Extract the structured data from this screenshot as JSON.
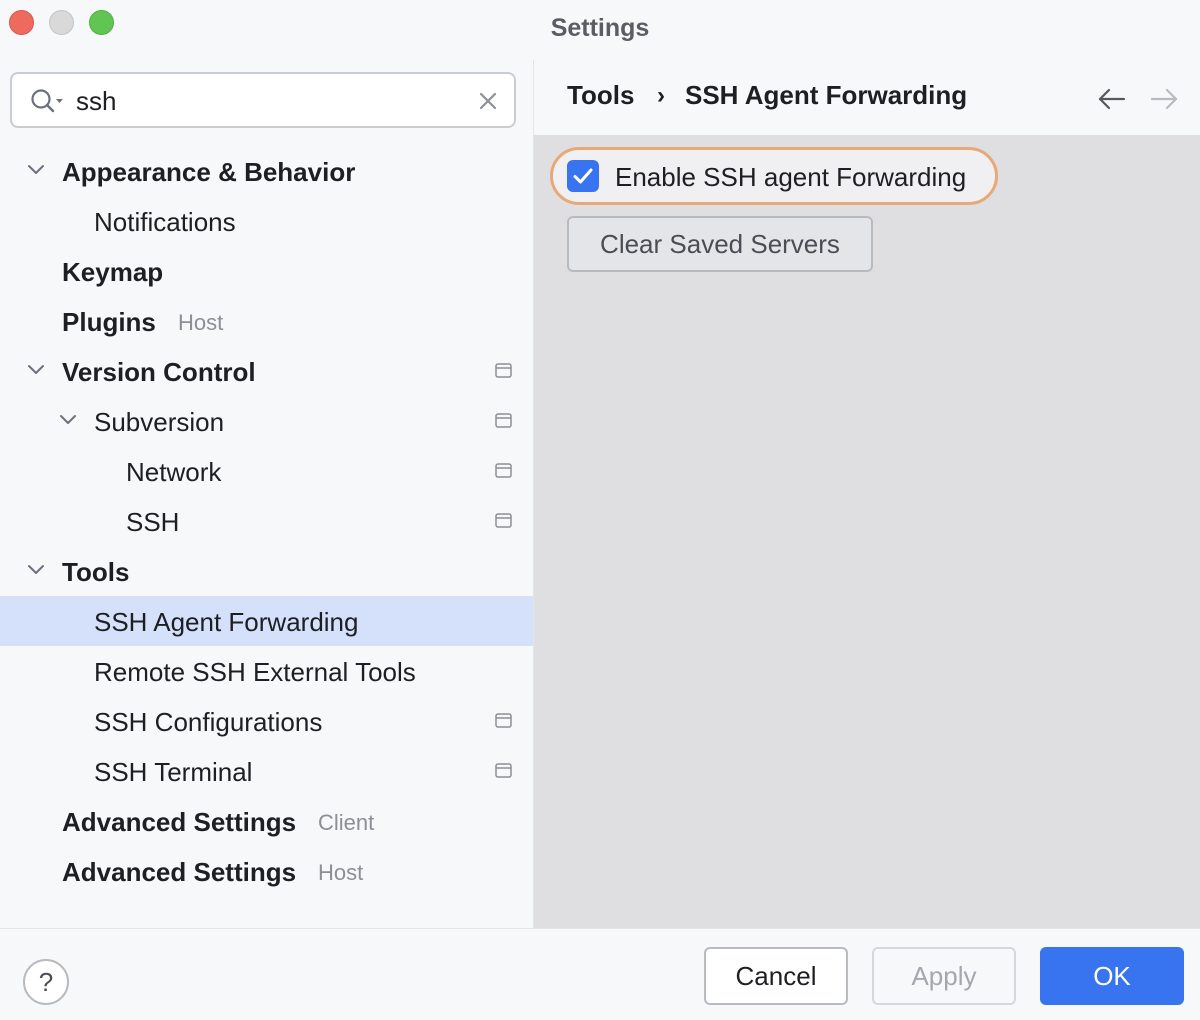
{
  "window": {
    "title": "Settings"
  },
  "search": {
    "value": "ssh",
    "placeholder": ""
  },
  "tree": [
    {
      "label": "Appearance & Behavior",
      "bold": true,
      "level": 0,
      "expanded": true,
      "hint": "",
      "icon": false,
      "selected": false
    },
    {
      "label": "Notifications",
      "bold": false,
      "level": 1,
      "expanded": null,
      "hint": "",
      "icon": false,
      "selected": false
    },
    {
      "label": "Keymap",
      "bold": true,
      "level": 0,
      "expanded": null,
      "hint": "",
      "icon": false,
      "selected": false
    },
    {
      "label": "Plugins",
      "bold": true,
      "level": 0,
      "expanded": null,
      "hint": "Host",
      "icon": false,
      "selected": false
    },
    {
      "label": "Version Control",
      "bold": true,
      "level": 0,
      "expanded": true,
      "hint": "",
      "icon": true,
      "selected": false
    },
    {
      "label": "Subversion",
      "bold": false,
      "level": 1,
      "expanded": true,
      "hint": "",
      "icon": true,
      "selected": false
    },
    {
      "label": "Network",
      "bold": false,
      "level": 2,
      "expanded": null,
      "hint": "",
      "icon": true,
      "selected": false
    },
    {
      "label": "SSH",
      "bold": false,
      "level": 2,
      "expanded": null,
      "hint": "",
      "icon": true,
      "selected": false
    },
    {
      "label": "Tools",
      "bold": true,
      "level": 0,
      "expanded": true,
      "hint": "",
      "icon": false,
      "selected": false
    },
    {
      "label": "SSH Agent Forwarding",
      "bold": false,
      "level": 1,
      "expanded": null,
      "hint": "",
      "icon": false,
      "selected": true
    },
    {
      "label": "Remote SSH External Tools",
      "bold": false,
      "level": 1,
      "expanded": null,
      "hint": "",
      "icon": false,
      "selected": false
    },
    {
      "label": "SSH Configurations",
      "bold": false,
      "level": 1,
      "expanded": null,
      "hint": "",
      "icon": true,
      "selected": false
    },
    {
      "label": "SSH Terminal",
      "bold": false,
      "level": 1,
      "expanded": null,
      "hint": "",
      "icon": true,
      "selected": false
    },
    {
      "label": "Advanced Settings",
      "bold": true,
      "level": 0,
      "expanded": null,
      "hint": "Client",
      "icon": false,
      "selected": false
    },
    {
      "label": "Advanced Settings",
      "bold": true,
      "level": 0,
      "expanded": null,
      "hint": "Host",
      "icon": false,
      "selected": false
    }
  ],
  "breadcrumb": {
    "parent": "Tools",
    "separator": "›",
    "current": "SSH Agent Forwarding"
  },
  "panel": {
    "checkbox_label": "Enable SSH agent Forwarding",
    "checkbox_checked": true,
    "clear_button": "Clear Saved Servers"
  },
  "footer": {
    "help": "?",
    "cancel": "Cancel",
    "apply": "Apply",
    "ok": "OK"
  },
  "colors": {
    "accent": "#3874f0",
    "selection": "#d5e1fb",
    "focus_ring": "#e8a978",
    "panel_bg": "#dfdfe1"
  }
}
